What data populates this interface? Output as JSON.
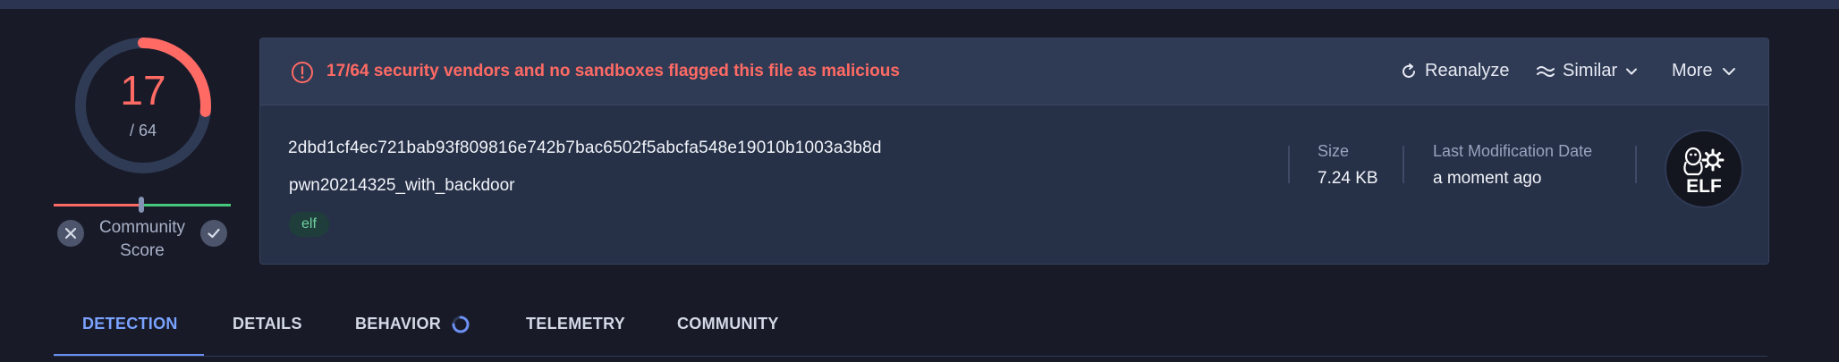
{
  "score": {
    "detections": "17",
    "total": "/ 64",
    "community_label": "Community Score",
    "fraction_flagged": 0.265625,
    "community_slider_value": 0.5
  },
  "alert": {
    "text": "17/64 security vendors and no sandboxes flagged this file as malicious"
  },
  "actions": {
    "reanalyze": "Reanalyze",
    "similar": "Similar",
    "more": "More"
  },
  "file": {
    "hash": "2dbd1cf4ec721bab93f809816e742b7bac6502f5abcfa548e19010b1003a3b8d",
    "name": "pwn20214325_with_backdoor",
    "tag": "elf"
  },
  "meta": {
    "size_label": "Size",
    "size_value": "7.24 KB",
    "modified_label": "Last Modification Date",
    "modified_value": "a moment ago"
  },
  "file_type_badge": "ELF",
  "tabs": [
    {
      "label": "DETECTION",
      "active": true
    },
    {
      "label": "DETAILS",
      "active": false
    },
    {
      "label": "BEHAVIOR",
      "active": false
    },
    {
      "label": "TELEMETRY",
      "active": false
    },
    {
      "label": "COMMUNITY",
      "active": false
    }
  ],
  "colors": {
    "background": "#181a28",
    "card": "#263148",
    "malicious": "#ff6a64",
    "active_tab": "#7aa2ff",
    "tag_text": "#6fd2a1"
  },
  "icons": {
    "alert": "alert-circle-icon",
    "reanalyze": "refresh-icon",
    "similar": "similar-icon",
    "chevron": "chevron-down-icon",
    "badge": "linux-penguin-gear-icon",
    "spinner": "loading-spinner-icon",
    "downvote": "close-icon",
    "upvote": "check-icon"
  }
}
